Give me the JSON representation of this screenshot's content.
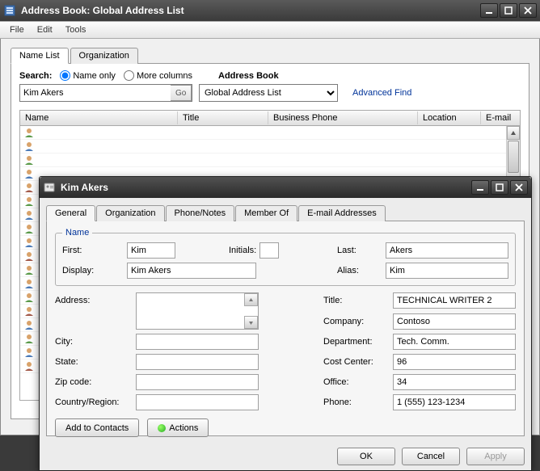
{
  "window": {
    "title": "Address Book: Global Address List",
    "menu": {
      "file": "File",
      "edit": "Edit",
      "tools": "Tools"
    }
  },
  "tabs": {
    "name_list": "Name List",
    "organization": "Organization"
  },
  "search": {
    "label": "Search:",
    "name_only": "Name only",
    "more_columns": "More columns",
    "value": "Kim Akers",
    "go": "Go",
    "addr_book_label": "Address Book",
    "addr_book_value": "Global Address List",
    "advanced_find": "Advanced Find"
  },
  "grid": {
    "cols": {
      "name": "Name",
      "title": "Title",
      "biz_phone": "Business Phone",
      "location": "Location",
      "email": "E-mail"
    }
  },
  "dialog": {
    "title": "Kim Akers",
    "tabs": {
      "general": "General",
      "organization": "Organization",
      "phone_notes": "Phone/Notes",
      "member_of": "Member Of",
      "email": "E-mail Addresses"
    },
    "groups": {
      "name_legend": "Name"
    },
    "labels": {
      "first": "First:",
      "initials": "Initials:",
      "last": "Last:",
      "display": "Display:",
      "alias": "Alias:",
      "address": "Address:",
      "title": "Title:",
      "company": "Company:",
      "city": "City:",
      "department": "Department:",
      "state": "State:",
      "cost_center": "Cost Center:",
      "zip": "Zip code:",
      "office": "Office:",
      "country": "Country/Region:",
      "phone": "Phone:"
    },
    "fields": {
      "first": "Kim",
      "initials": "",
      "last": "Akers",
      "display": "Kim Akers",
      "alias": "Kim",
      "address": "",
      "title": "TECHNICAL WRITER 2",
      "company": "Contoso",
      "city": "",
      "department": "Tech. Comm.",
      "state": "",
      "cost_center": "96",
      "zip": "",
      "office": "34",
      "country": "",
      "phone": "1 (555) 123-1234"
    },
    "buttons": {
      "add_to_contacts": "Add to Contacts",
      "actions": "Actions",
      "ok": "OK",
      "cancel": "Cancel",
      "apply": "Apply"
    }
  }
}
